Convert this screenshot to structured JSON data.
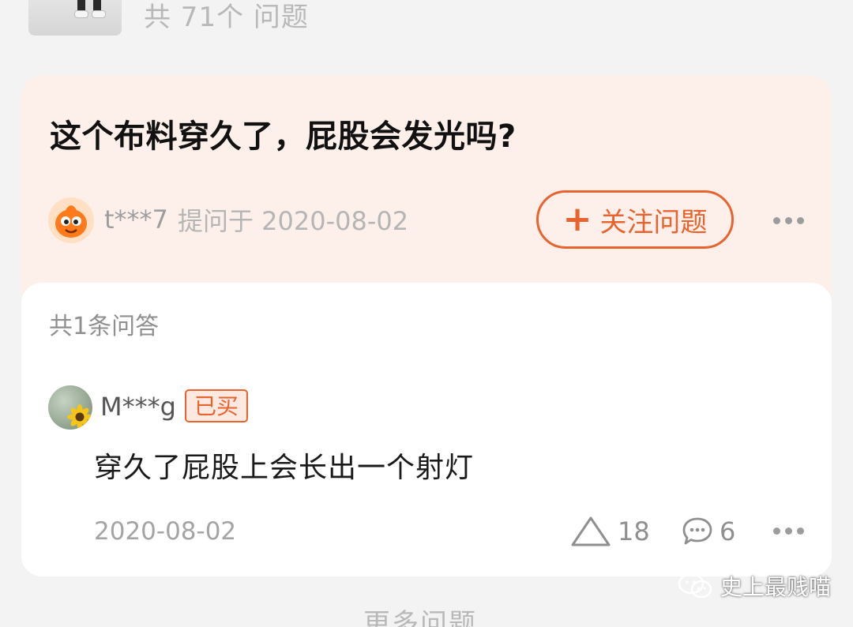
{
  "top": {
    "question_count": "共 71个 问题"
  },
  "question": {
    "title": "这个布料穿久了，屁股会发光吗?",
    "asker_name": "t***7",
    "asked_meta": "提问于 2020-08-02",
    "follow_label": "关注问题",
    "follow_icon": "+"
  },
  "answers": {
    "count_label": "共1条问答",
    "items": [
      {
        "user": "M***g",
        "badge": "已买",
        "text": "穿久了屁股上会长出一个射灯",
        "date": "2020-08-02",
        "likes": "18",
        "comments": "6"
      }
    ]
  },
  "footer": {
    "more_label": "更多问题"
  },
  "watermark": {
    "text": "史上最贱喵"
  },
  "colors": {
    "accent": "#e8632d",
    "question_bg": "#fdf0eb",
    "page_bg": "#f3f3f3"
  }
}
